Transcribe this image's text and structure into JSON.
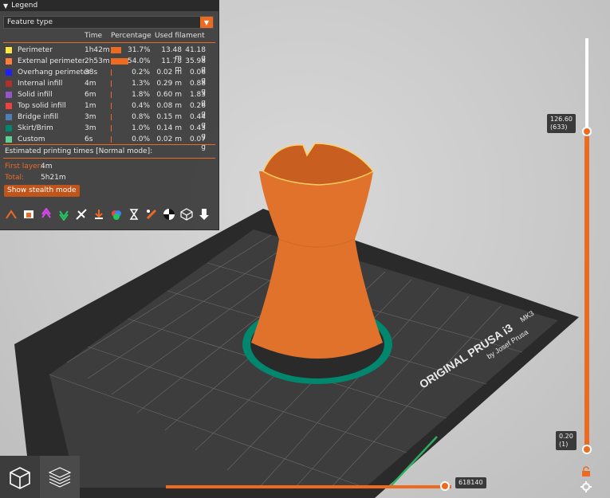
{
  "legend": {
    "title": "Legend",
    "view_type": "Feature type",
    "columns": {
      "time": "Time",
      "percentage": "Percentage",
      "used_filament": "Used filament"
    },
    "rows": [
      {
        "name": "Perimeter",
        "color": "#ffe63c",
        "time": "1h42m",
        "pct": "31.7%",
        "pct_value": 31.7,
        "length": "13.48 m",
        "weight": "41.18 g"
      },
      {
        "name": "External perimeter",
        "color": "#ff7d38",
        "time": "2h53m",
        "pct": "54.0%",
        "pct_value": 54.0,
        "length": "11.78 m",
        "weight": "35.98 g"
      },
      {
        "name": "Overhang perimeter",
        "color": "#1f1fff",
        "time": "38s",
        "pct": "0.2%",
        "pct_value": 0.2,
        "length": "0.02 m",
        "weight": "0.06 g"
      },
      {
        "name": "Internal infill",
        "color": "#b03029",
        "time": "4m",
        "pct": "1.3%",
        "pct_value": 1.3,
        "length": "0.29 m",
        "weight": "0.88 g"
      },
      {
        "name": "Solid infill",
        "color": "#9654cc",
        "time": "6m",
        "pct": "1.8%",
        "pct_value": 1.8,
        "length": "0.60 m",
        "weight": "1.83 g"
      },
      {
        "name": "Top solid infill",
        "color": "#f04040",
        "time": "1m",
        "pct": "0.4%",
        "pct_value": 0.4,
        "length": "0.08 m",
        "weight": "0.26 g"
      },
      {
        "name": "Bridge infill",
        "color": "#4d80ba",
        "time": "3m",
        "pct": "0.8%",
        "pct_value": 0.8,
        "length": "0.15 m",
        "weight": "0.44 g"
      },
      {
        "name": "Skirt/Brim",
        "color": "#00876e",
        "time": "3m",
        "pct": "1.0%",
        "pct_value": 1.0,
        "length": "0.14 m",
        "weight": "0.43 g"
      },
      {
        "name": "Custom",
        "color": "#5ed194",
        "time": "6s",
        "pct": "0.0%",
        "pct_value": 0.0,
        "length": "0.02 m",
        "weight": "0.07 g"
      }
    ],
    "estimated_label": "Estimated printing times [Normal mode]:",
    "first_layer_label": "First layer:",
    "first_layer_value": "4m",
    "total_label": "Total:",
    "total_value": "5h21m",
    "stealth_button": "Show stealth mode"
  },
  "vertical_slider": {
    "top_value": "126.60",
    "top_layer": "(633)",
    "bottom_value": "0.20",
    "bottom_layer": "(1)"
  },
  "horizontal_slider": {
    "value": "618140"
  },
  "bed_text": {
    "line1": "ORIGINAL PRUSA i3",
    "model": "MK3",
    "line2": "by Josef Prusa"
  },
  "colors": {
    "accent": "#ed6b21",
    "object": "#e0722c",
    "brim": "#00876e"
  }
}
